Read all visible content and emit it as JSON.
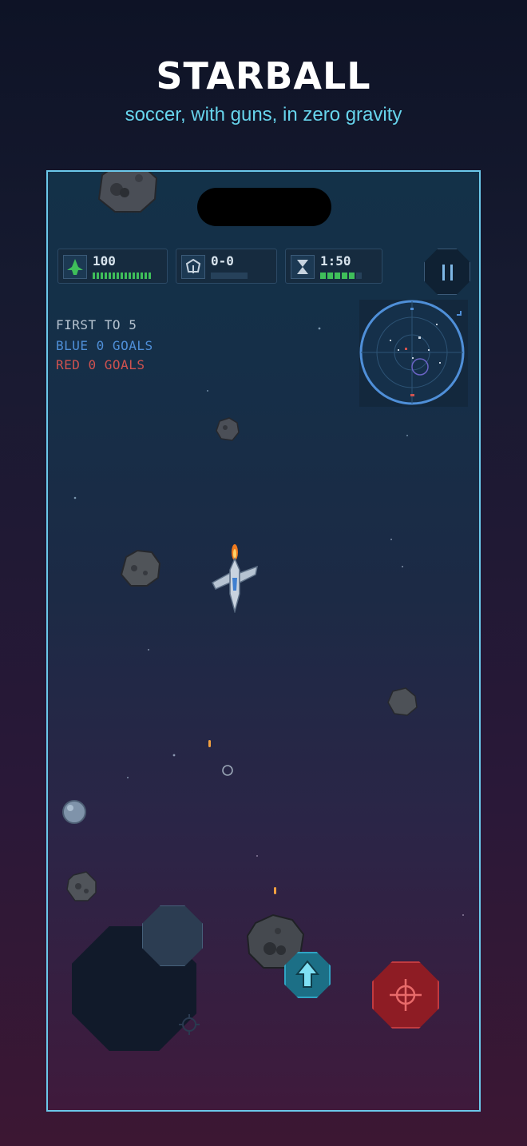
{
  "header": {
    "title": "STARBALL",
    "subtitle": "soccer, with guns, in zero gravity"
  },
  "hud": {
    "health": {
      "icon": "ship-icon",
      "value": "100",
      "fill": 1.0
    },
    "score": {
      "icon": "ball-icon",
      "value": "0-0",
      "fill": 0.0
    },
    "timer": {
      "icon": "hourglass-icon",
      "value": "1:50",
      "fill": 0.83
    }
  },
  "status": {
    "rule": "FIRST TO 5",
    "blue": "BLUE 0 GOALS",
    "red": "RED 0 GOALS"
  },
  "colors": {
    "accent": "#6bc8ea",
    "blue_team": "#4f8fd8",
    "red_team": "#d0524f",
    "health_bar": "#3fbf5a",
    "timer_bar": "#3fbf5a",
    "fire_button": "#8e1c24",
    "boost_button": "#1c6f86"
  },
  "controls": {
    "pause": "pause-icon",
    "boost": "boost-arrow-icon",
    "fire": "crosshair-icon",
    "joystick": "joystick"
  }
}
